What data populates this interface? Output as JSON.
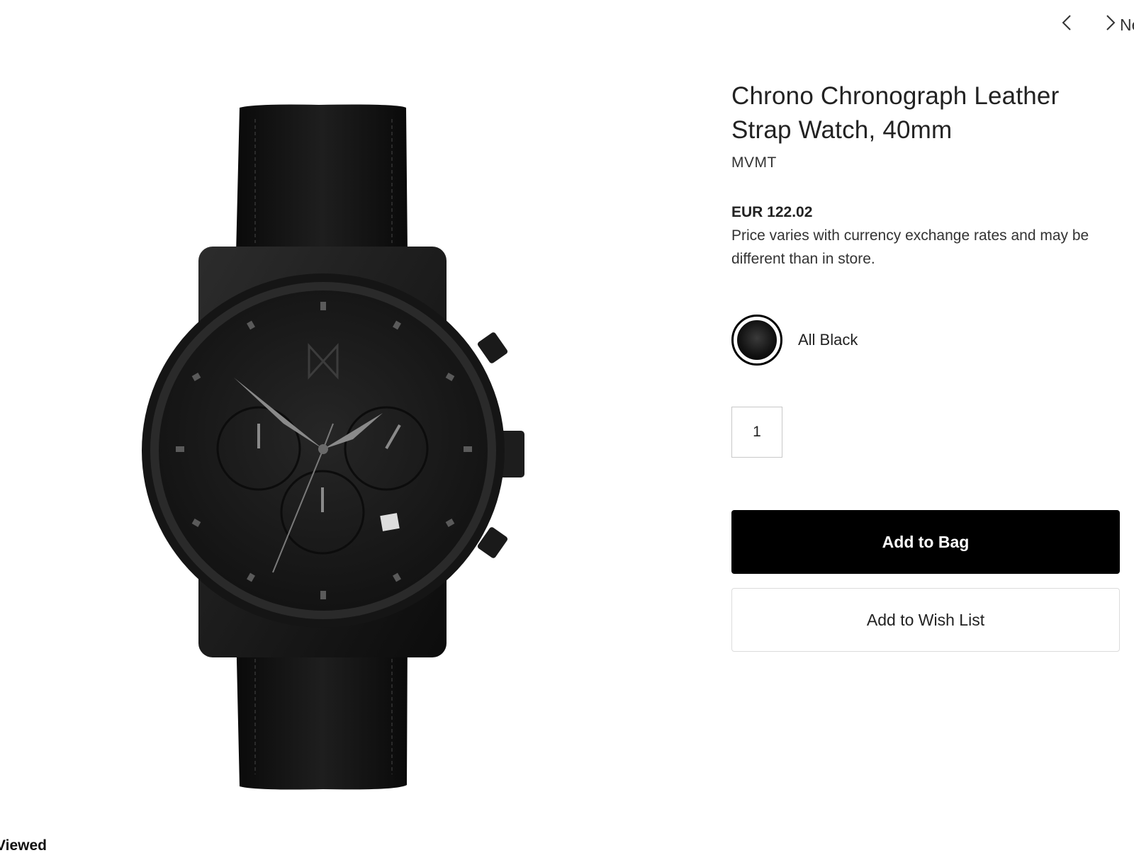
{
  "nav": {
    "prev_icon": "chevron-left-icon",
    "next_icon": "chevron-right-icon",
    "next_label": "Next"
  },
  "product": {
    "title": "Chrono Chronograph Leather Strap Watch, 40mm",
    "brand": "MVMT",
    "price": "EUR 122.02",
    "price_note": "Price varies with currency exchange rates and may be different than in store.",
    "color_name": "All Black",
    "quantity": "1",
    "add_to_bag_label": "Add to Bag",
    "add_to_wish_label": "Add to Wish List"
  },
  "footer": {
    "recently_viewed_heading": "Recently Viewed"
  },
  "colors": {
    "primary_button_bg": "#000000",
    "primary_button_text": "#ffffff",
    "border": "#dcdcdc"
  }
}
